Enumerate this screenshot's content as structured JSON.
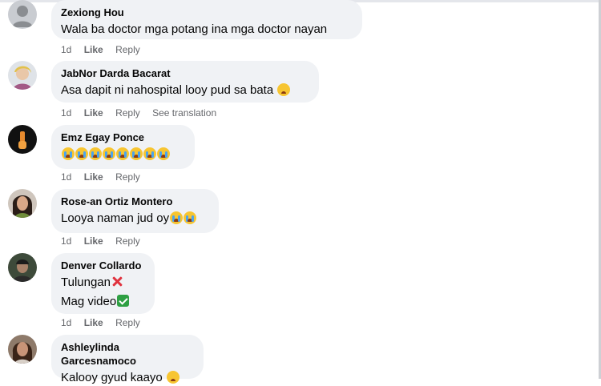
{
  "comments": [
    {
      "author": "Zexiong Hou",
      "lines": [
        "Wala ba doctor mga potang ina mga doctor nayan"
      ],
      "time": "1d",
      "like": "Like",
      "reply": "Reply"
    },
    {
      "author": "JabNor Darda Bacarat",
      "lines": [
        "Asa dapit ni nahospital looy pud sa bata"
      ],
      "time": "1d",
      "like": "Like",
      "reply": "Reply",
      "translate": "See translation"
    },
    {
      "author": "Emz Egay Ponce",
      "lines": [
        ""
      ],
      "time": "1d",
      "like": "Like",
      "reply": "Reply"
    },
    {
      "author": "Rose-an Ortiz Montero",
      "lines": [
        "Looya naman jud oy"
      ],
      "time": "1d",
      "like": "Like",
      "reply": "Reply"
    },
    {
      "author": "Denver Collardo",
      "lines": [
        "Tulungan",
        "Mag video"
      ],
      "time": "1d",
      "like": "Like",
      "reply": "Reply"
    },
    {
      "author": "Ashleylinda Garcesnamoco",
      "lines": [
        "Kalooy gyud kaayo"
      ],
      "time": "",
      "like": "",
      "reply": ""
    }
  ],
  "icons": {
    "cry_emoji": "loudly-crying-face-emoji",
    "sad_emoji": "pleading-sad-face-emoji",
    "x_mark": "cross-mark-emoji",
    "check_mark": "check-mark-button-emoji"
  },
  "colors": {
    "bubble": "#f0f2f5",
    "meta_text": "#65676b",
    "text": "#050505"
  }
}
